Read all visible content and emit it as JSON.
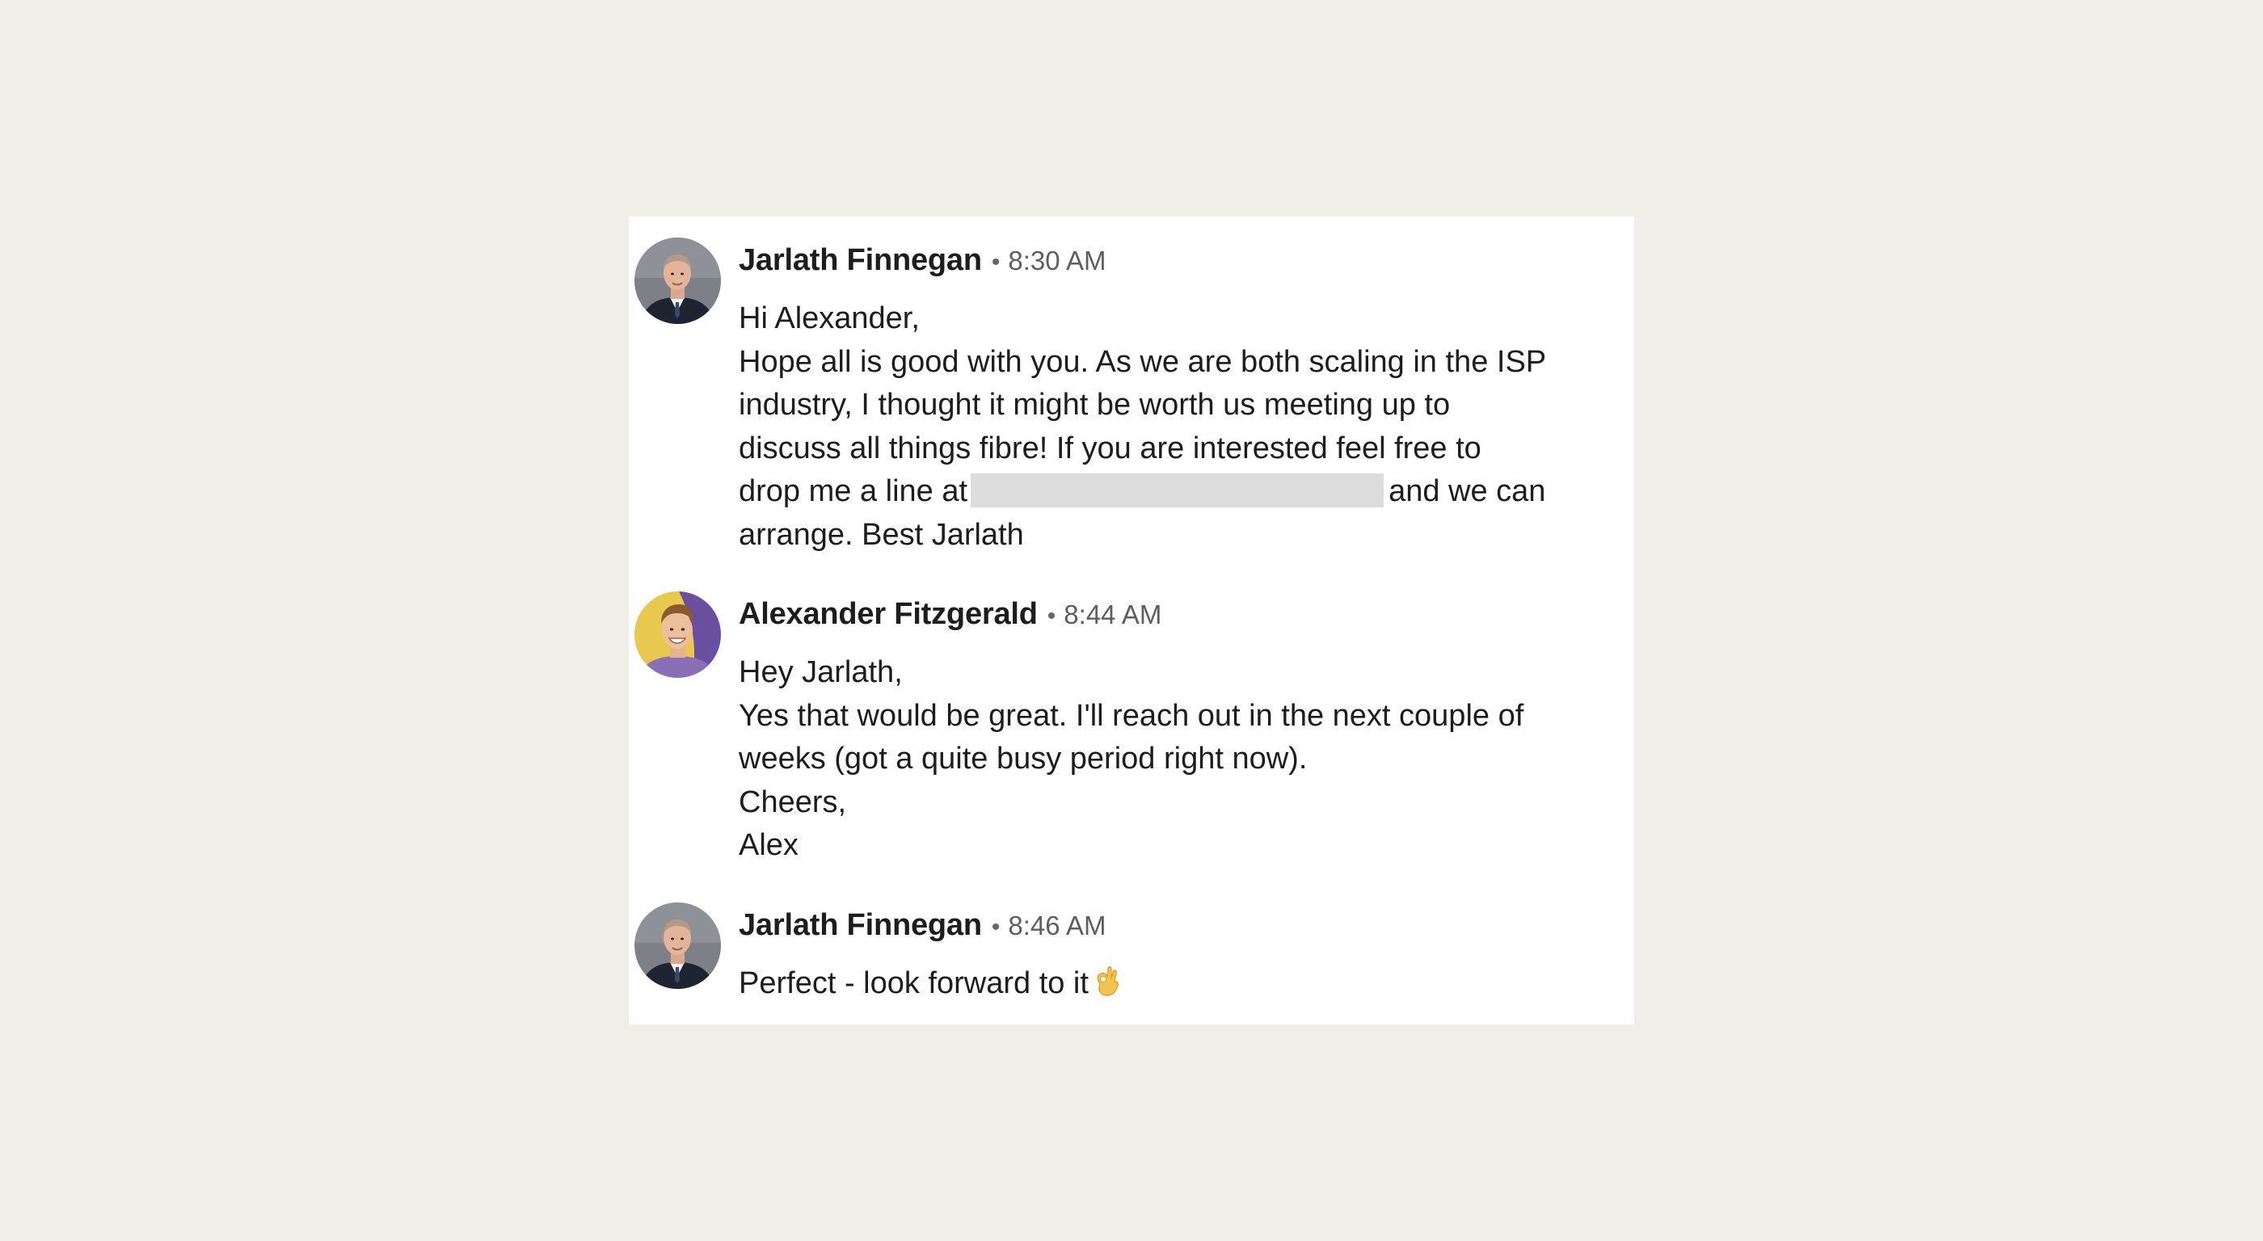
{
  "colors": {
    "page_background": "#efefe8",
    "panel_background": "#ffffff",
    "text": "#1d1d1d",
    "timestamp": "#5f5f5f",
    "redaction": "#dcdcdc"
  },
  "messages": [
    {
      "sender": "Jarlath Finnegan",
      "separator": "•",
      "time": "8:30 AM",
      "avatar_icon": "person-avatar-dark-suit",
      "lines": [
        "Hi Alexander,",
        "Hope all is good with you. As we are both scaling in the ISP",
        "industry, I thought it might be worth us meeting up to",
        "discuss all things fibre! If you are interested feel free to"
      ],
      "redacted_line": {
        "before": "drop me a line at",
        "after": "and we can"
      },
      "last_line": "arrange. Best Jarlath"
    },
    {
      "sender": "Alexander Fitzgerald",
      "separator": "•",
      "time": "8:44 AM",
      "avatar_icon": "person-avatar-yellow-purple-background",
      "lines": [
        "Hey Jarlath,",
        "Yes that would be great. I'll reach out in the next couple of",
        "weeks (got a quite busy period right now).",
        "Cheers,",
        "Alex"
      ]
    },
    {
      "sender": "Jarlath Finnegan",
      "separator": "•",
      "time": "8:46 AM",
      "avatar_icon": "person-avatar-dark-suit",
      "text": "Perfect - look forward to it",
      "emoji_icon": "ok-hand-emoji-icon"
    }
  ]
}
